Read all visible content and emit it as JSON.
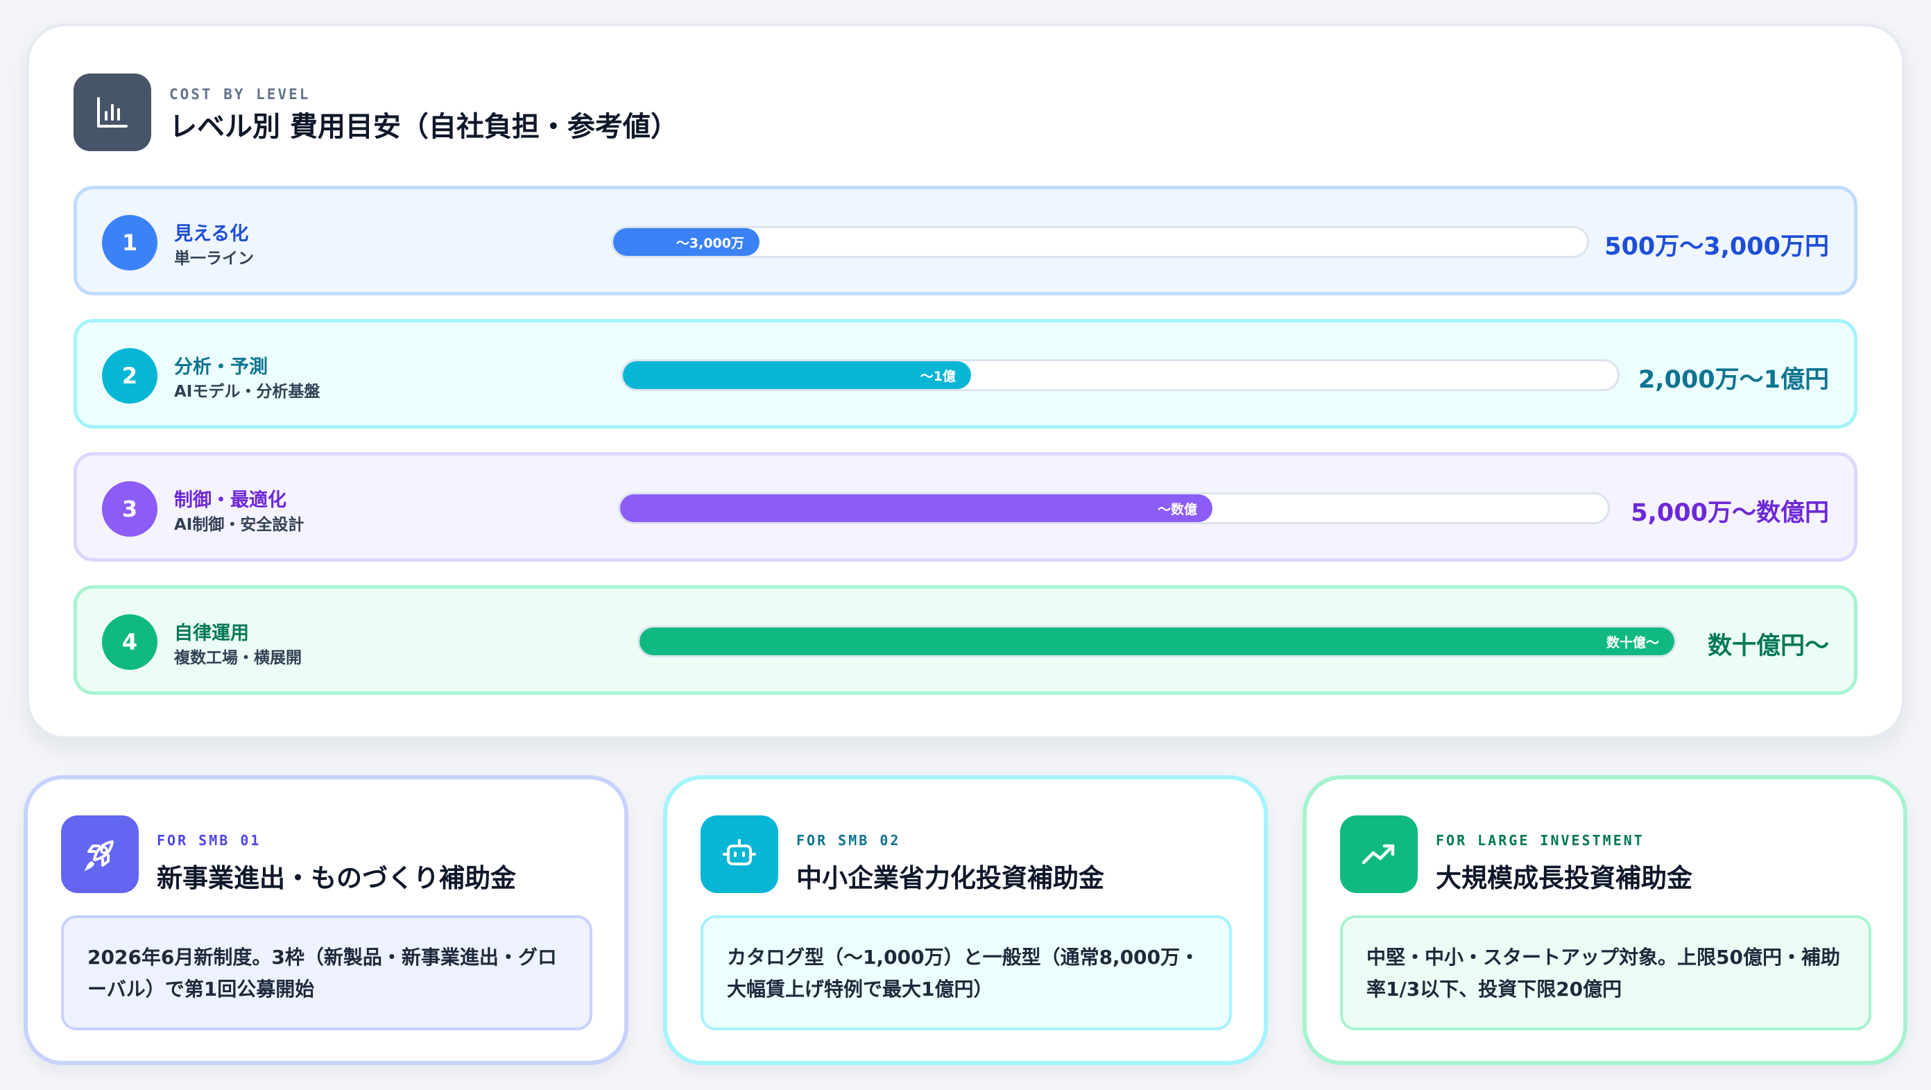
{
  "header": {
    "eyebrow": "COST BY LEVEL",
    "title": "レベル別 費用目安（自社負担・参考値）",
    "icon": "bar-chart-icon"
  },
  "levels": [
    {
      "num": "1",
      "name": "見える化",
      "sub": "単一ライン",
      "bar_label": "〜3,000万",
      "fill_fraction": 0.15,
      "range": "500万〜3,000万円",
      "color": "#3b82f6",
      "text_color": "#1d4ed8",
      "bg": "#eff6ff",
      "border": "#bfdbfe"
    },
    {
      "num": "2",
      "name": "分析・予測",
      "sub": "AIモデル・分析基盤",
      "bar_label": "〜1億",
      "fill_fraction": 0.35,
      "range": "2,000万〜1億円",
      "color": "#06b6d4",
      "text_color": "#0e7490",
      "bg": "#ecfeff",
      "border": "#a5f3fc"
    },
    {
      "num": "3",
      "name": "制御・最適化",
      "sub": "AI制御・安全設計",
      "bar_label": "〜数億",
      "fill_fraction": 0.6,
      "range": "5,000万〜数億円",
      "color": "#8b5cf6",
      "text_color": "#6d28d9",
      "bg": "#f5f3ff",
      "border": "#ddd6fe"
    },
    {
      "num": "4",
      "name": "自律運用",
      "sub": "複数工場・横展開",
      "bar_label": "数十億〜",
      "fill_fraction": 1.0,
      "range": "数十億円〜",
      "color": "#10b981",
      "text_color": "#047857",
      "bg": "#ecfdf5",
      "border": "#a7f3d0"
    }
  ],
  "subsidies": [
    {
      "eyebrow": "FOR SMB 01",
      "title": "新事業進出・ものづくり補助金",
      "desc": "2026年6月新制度。3枠（新製品・新事業進出・グローバル）で第1回公募開始",
      "icon": "rocket-icon",
      "accent": "#6366f1",
      "eyebrow_color": "#4f46e5",
      "border": "#c7d2fe",
      "desc_bg": "#eef2ff",
      "desc_border": "#c7d2fe"
    },
    {
      "eyebrow": "FOR SMB 02",
      "title": "中小企業省力化投資補助金",
      "desc": "カタログ型（〜1,000万）と一般型（通常8,000万・大幅賃上げ特例で最大1億円）",
      "icon": "robot-icon",
      "accent": "#06b6d4",
      "eyebrow_color": "#0e7490",
      "border": "#a5f3fc",
      "desc_bg": "#ecfeff",
      "desc_border": "#a5f3fc"
    },
    {
      "eyebrow": "FOR LARGE INVESTMENT",
      "title": "大規模成長投資補助金",
      "desc": "中堅・中小・スタートアップ対象。上限50億円・補助率1/3以下、投資下限20億円",
      "icon": "trending-up-icon",
      "accent": "#10b981",
      "eyebrow_color": "#047857",
      "border": "#a7f3d0",
      "desc_bg": "#ecfdf5",
      "desc_border": "#a7f3d0"
    }
  ]
}
